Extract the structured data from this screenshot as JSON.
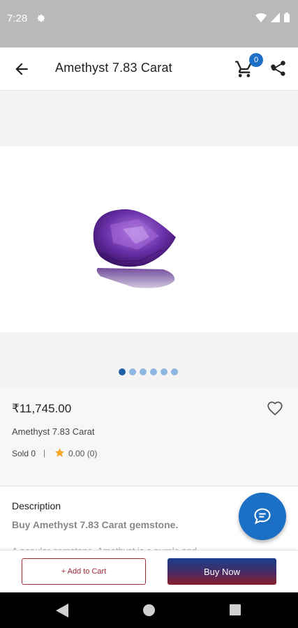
{
  "status_bar": {
    "time": "7:28"
  },
  "app_bar": {
    "title": "Amethyst 7.83 Carat",
    "cart_count": "0"
  },
  "product": {
    "price": "₹11,745.00",
    "name": "Amethyst 7.83 Carat",
    "sold": "Sold 0",
    "separator": "|",
    "rating": "0.00 (0)",
    "image_count": 6,
    "active_image": 1
  },
  "description": {
    "heading": "Description",
    "title": "Buy Amethyst 7.83 Carat gemstone.",
    "body": "A popular gemstone, Amethyst is a purple and"
  },
  "actions": {
    "add_to_cart": "+ Add to Cart",
    "buy_now": "Buy Now"
  },
  "colors": {
    "accent": "#1e6fc7",
    "brand_red": "#9b2a38",
    "rating_star": "#f5a623"
  }
}
